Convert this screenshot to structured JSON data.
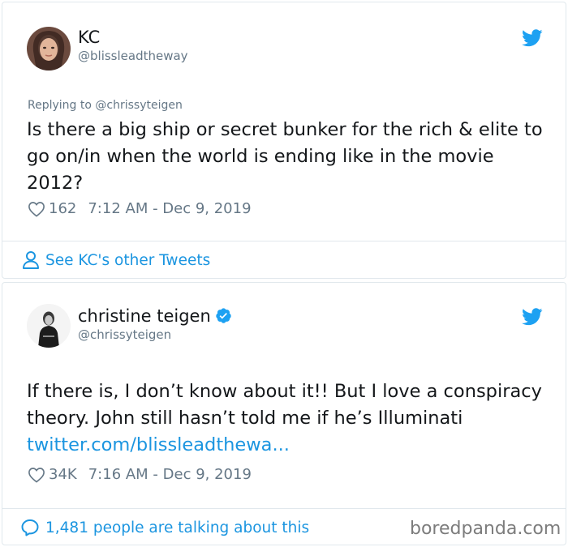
{
  "tweet1": {
    "name": "KC",
    "handle": "@blissleadtheway",
    "reply_prefix": "Replying to ",
    "reply_handle": "@chrissyteigen",
    "text": "Is there a big ship or secret bunker for the rich & elite to go on/in when the world is ending like in the movie 2012?",
    "likes": "162",
    "timestamp": "7:12 AM - Dec 9, 2019",
    "footer_label": "See KC's other Tweets"
  },
  "tweet2": {
    "name": "christine teigen",
    "handle": "@chrissyteigen",
    "text": "If there is, I don’t know about it!! But I love a conspiracy theory. John still hasn’t told me if he’s Illuminati ",
    "link_text": "twitter.com/blissleadthewa...",
    "likes": "34K",
    "timestamp": "7:16 AM - Dec 9, 2019",
    "footer_label": "1,481 people are talking about this"
  },
  "watermark": "boredpanda.com",
  "colors": {
    "twitter_blue": "#1da1f2",
    "link_blue": "#1b95e0",
    "secondary_text": "#657786",
    "border": "#e1e8ed"
  },
  "icons": [
    "twitter-bird-icon",
    "heart-icon",
    "person-icon",
    "comment-bubble-icon",
    "verified-badge-icon"
  ]
}
